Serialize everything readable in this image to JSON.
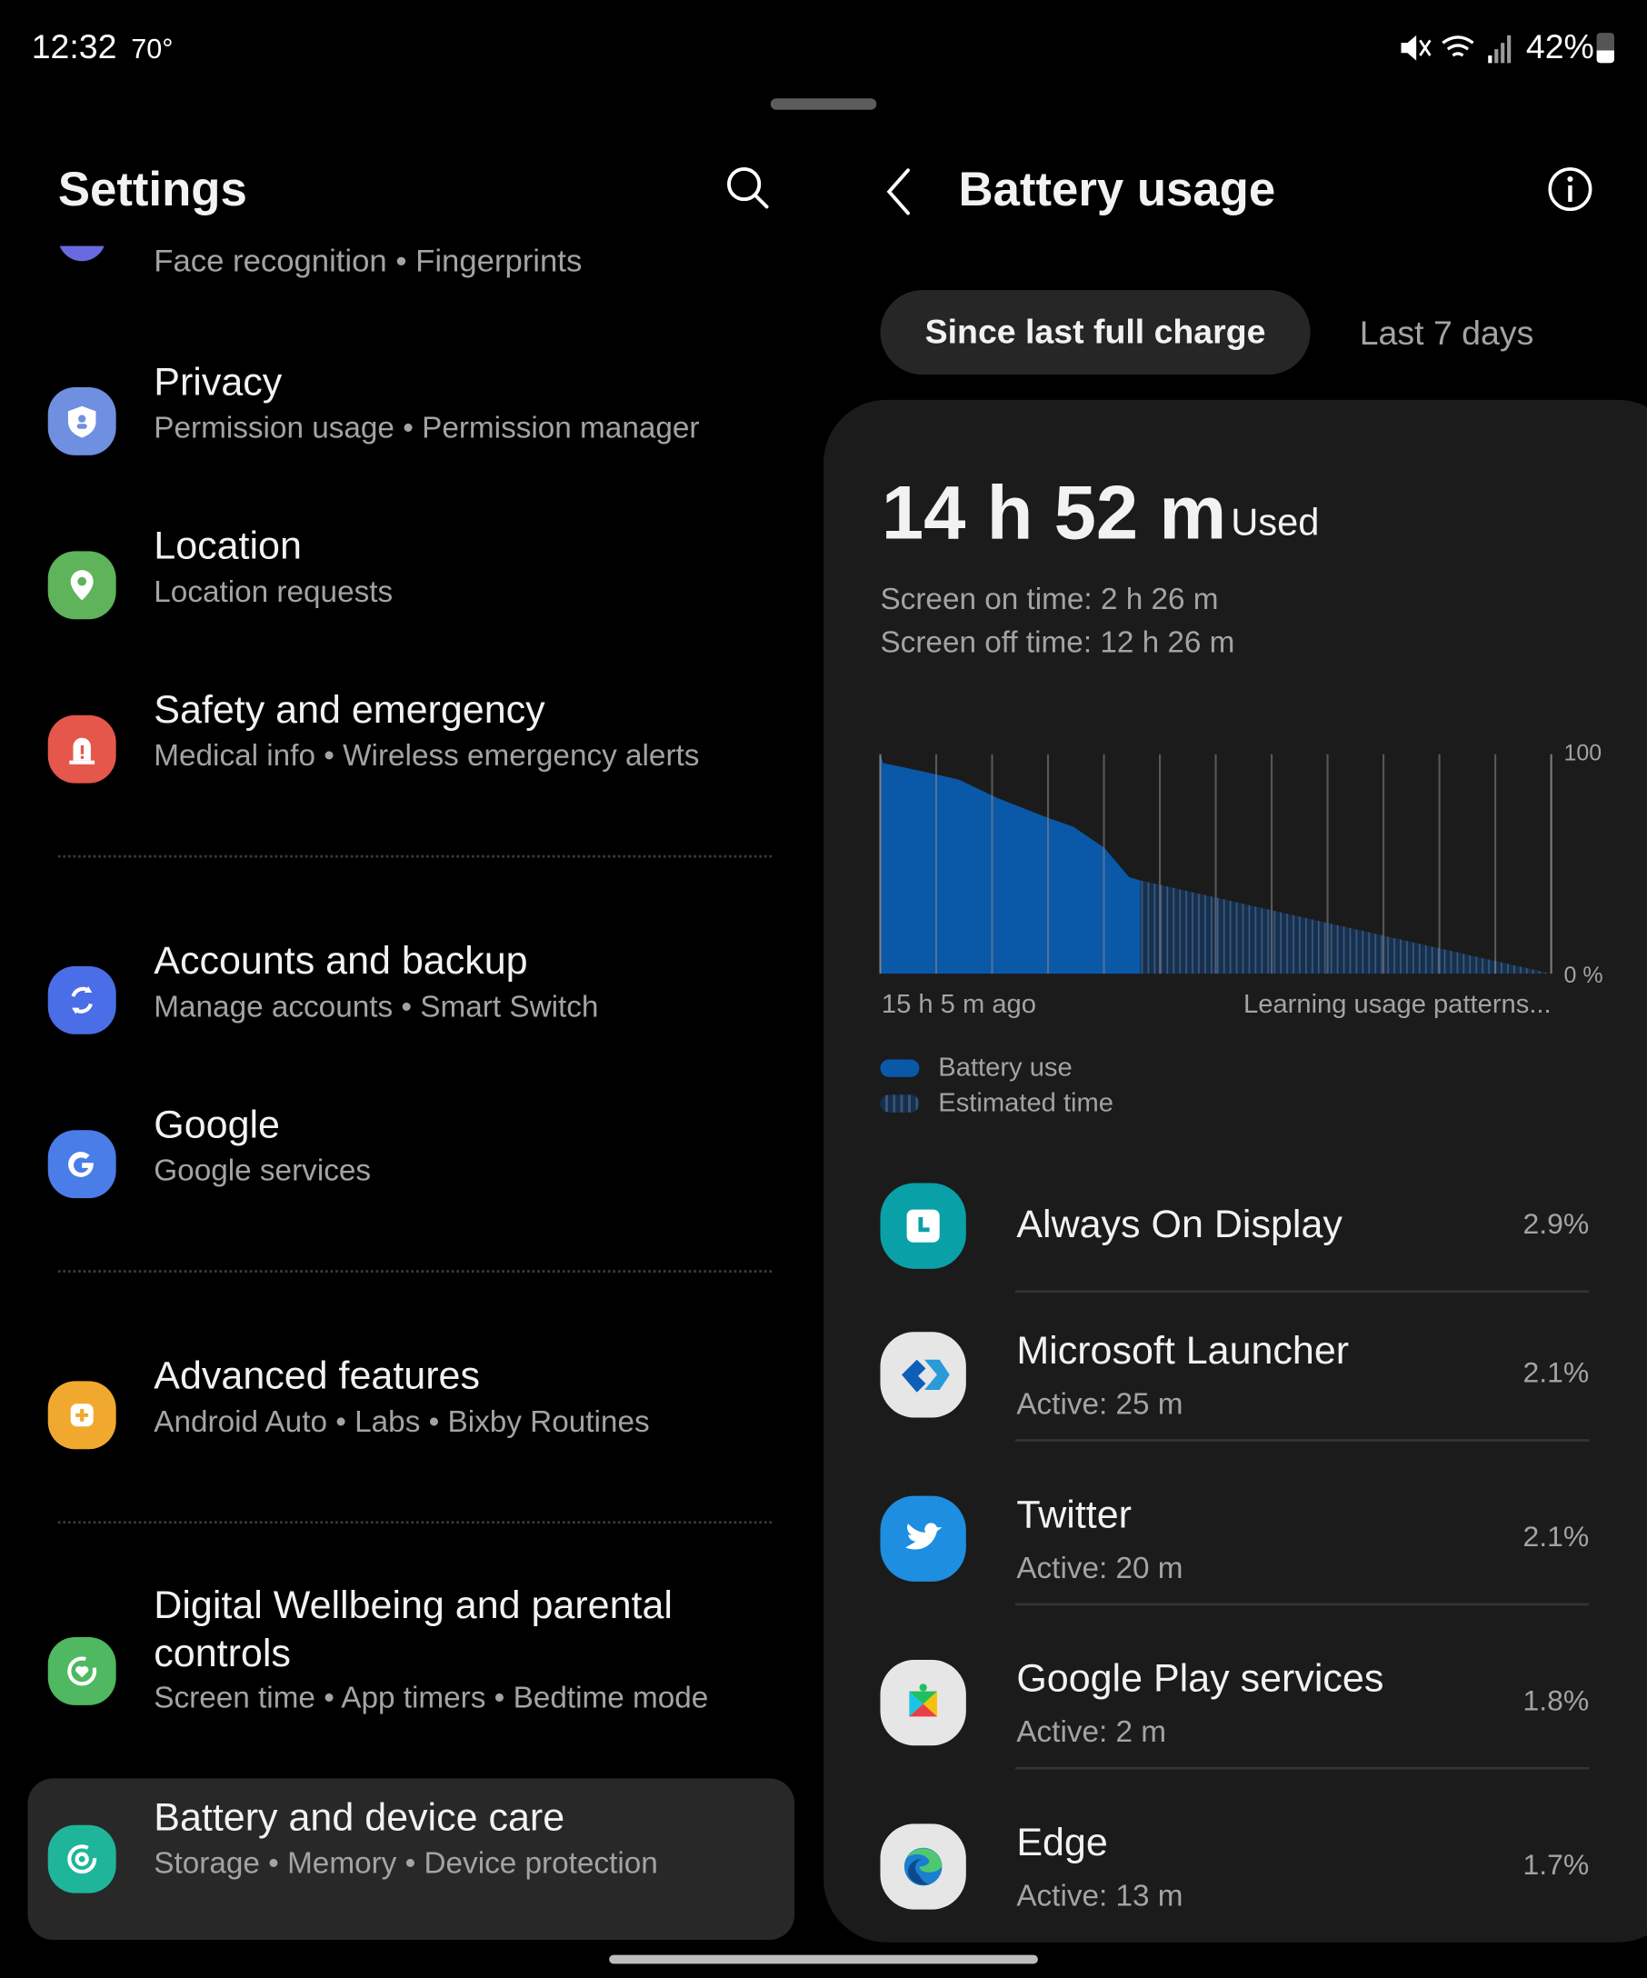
{
  "status_bar": {
    "time": "12:32",
    "temperature": "70°",
    "battery": "42%",
    "icons": [
      "mute-icon",
      "wifi-icon",
      "signal-icon",
      "battery-icon"
    ]
  },
  "left": {
    "title": "Settings",
    "partial_item": "Face recognition  •  Fingerprints",
    "items": [
      {
        "title": "Privacy",
        "subtitle": "Permission usage  •  Permission manager",
        "icon": "privacy-shield-icon",
        "color": "#6f8fe0"
      },
      {
        "title": "Location",
        "subtitle": "Location requests",
        "icon": "location-pin-icon",
        "color": "#5fb35a"
      },
      {
        "title": "Safety and emergency",
        "subtitle": "Medical info  •  Wireless emergency alerts",
        "icon": "siren-icon",
        "color": "#e5574b"
      },
      {
        "title": "Accounts and backup",
        "subtitle": "Manage accounts  •  Smart Switch",
        "icon": "sync-icon",
        "color": "#4a6ee8"
      },
      {
        "title": "Google",
        "subtitle": "Google services",
        "icon": "google-icon",
        "color": "#4a7de8"
      },
      {
        "title": "Advanced features",
        "subtitle": "Android Auto  •  Labs  •  Bixby Routines",
        "icon": "puzzle-plus-icon",
        "color": "#f0a92e"
      },
      {
        "title": "Digital Wellbeing and parental controls",
        "subtitle": "Screen time  •  App timers  •  Bedtime mode",
        "icon": "wellbeing-icon",
        "color": "#4fb860"
      },
      {
        "title": "Battery and device care",
        "subtitle": "Storage  •  Memory  •  Device protection",
        "icon": "device-care-icon",
        "color": "#1fb59a",
        "selected": true
      }
    ]
  },
  "right": {
    "title": "Battery usage",
    "tabs": [
      {
        "label": "Since last full charge",
        "active": true
      },
      {
        "label": "Last 7 days",
        "active": false
      }
    ],
    "used_value": "14 h 52 m",
    "used_label": "Used",
    "screen_on": "Screen on time: 2 h 26 m",
    "screen_off": "Screen off time: 12 h 26 m",
    "apps": [
      {
        "name": "Always On Display",
        "active": "",
        "percent": "2.9%",
        "icon": "always-on-display-icon"
      },
      {
        "name": "Microsoft Launcher",
        "active": "Active: 25 m",
        "percent": "2.1%",
        "icon": "microsoft-launcher-icon"
      },
      {
        "name": "Twitter",
        "active": "Active: 20 m",
        "percent": "2.1%",
        "icon": "twitter-icon"
      },
      {
        "name": "Google Play services",
        "active": "Active: 2 m",
        "percent": "1.8%",
        "icon": "google-play-services-icon"
      },
      {
        "name": "Edge",
        "active": "Active: 13 m",
        "percent": "1.7%",
        "icon": "edge-icon"
      }
    ]
  },
  "chart_data": {
    "type": "area",
    "x_label_left": "15 h 5 m ago",
    "x_label_right": "Learning usage patterns...",
    "y_ticks": [
      "100",
      "0 %"
    ],
    "ylim": [
      0,
      100
    ],
    "xlim": [
      0,
      24
    ],
    "grid": "vertical",
    "legend": [
      {
        "name": "Battery use",
        "color": "#0a58a8"
      },
      {
        "name": "Estimated time",
        "color": "#17304d"
      }
    ],
    "legend_placement": "bottom-left",
    "battery_use": {
      "x": [
        0,
        0.1,
        1.4,
        2.8,
        4.2,
        6.0,
        6.9,
        8.0,
        8.9,
        9.3
      ],
      "y": [
        100,
        96,
        92.5,
        88.5,
        80,
        71,
        67,
        57.5,
        44,
        42.5
      ]
    },
    "estimated": {
      "x": [
        9.3,
        24
      ],
      "y": [
        42.5,
        0
      ]
    }
  }
}
